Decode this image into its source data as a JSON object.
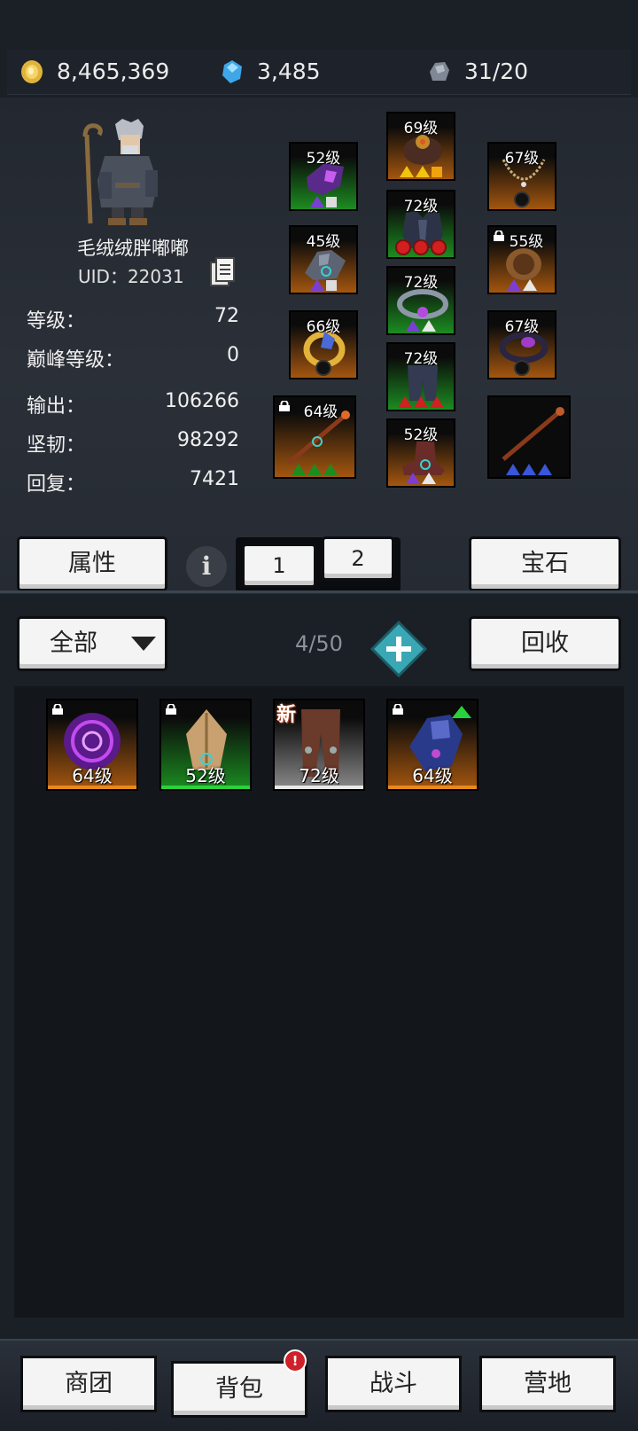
{
  "currency": {
    "gold": "8,465,369",
    "gems": "3,485",
    "stones": "31/20"
  },
  "character": {
    "name": "毛绒绒胖嘟嘟",
    "uid_label": "UID：",
    "uid": "22031"
  },
  "stats": [
    {
      "label": "等级：",
      "value": "72"
    },
    {
      "label": "巅峰等级：",
      "value": "0"
    },
    {
      "label": "输出：",
      "value": "106266"
    },
    {
      "label": "坚韧：",
      "value": "98292"
    },
    {
      "label": "回复：",
      "value": "7421"
    }
  ],
  "equipment": {
    "helm": {
      "level": "69级"
    },
    "chest_left": {
      "level": "52级"
    },
    "necklace": {
      "level": "67级"
    },
    "armor": {
      "level": "72级"
    },
    "gloves": {
      "level": "45级"
    },
    "bracer": {
      "level": "55级"
    },
    "belt": {
      "level": "72级"
    },
    "ring_left": {
      "level": "66级"
    },
    "ring_right": {
      "level": "67级"
    },
    "legs": {
      "level": "72级"
    },
    "weapon": {
      "level": "64级"
    },
    "boots": {
      "level": "52级"
    }
  },
  "buttons": {
    "attributes": "属性",
    "info": "i",
    "set1": "1",
    "set2": "2",
    "gems": "宝石",
    "filter": "全部",
    "recycle": "回收"
  },
  "inventory": {
    "count": "4/50",
    "items": [
      {
        "level": "64级",
        "new": ""
      },
      {
        "level": "52级",
        "new": ""
      },
      {
        "level": "72级",
        "new": "新"
      },
      {
        "level": "64级",
        "new": ""
      }
    ]
  },
  "nav": {
    "guild": "商团",
    "bag": "背包",
    "bag_badge": "!",
    "battle": "战斗",
    "camp": "营地"
  },
  "colors": {
    "orange": "#a4560f",
    "green": "#1c8c21",
    "purple": "#7a3fd1",
    "red": "#d21f1f",
    "blue": "#3a56d9",
    "teal": "#3aa7b4"
  }
}
